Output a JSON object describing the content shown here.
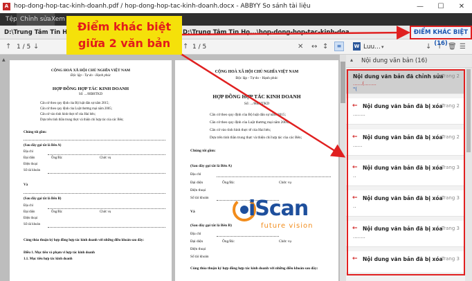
{
  "window": {
    "title": "hop-dong-hop-tac-kinh-doanh.pdf / hop-dong-hop-tac-kinh-doanh.docx - ABBYY So sánh tài liệu",
    "app_icon": "abbyy-pdf-icon"
  },
  "menu": {
    "items": [
      "Tệp",
      "Chỉnh sửa",
      "Xem"
    ]
  },
  "paths": {
    "left": "D:\\Trung Tâm Tin Học",
    "right": "D:\\Trung Tâm Tin Họ...\\hop-dong-hop-tac-kinh-doanh.docx"
  },
  "toolbar": {
    "left_page": "1 / 5",
    "right_page": "1 / 5",
    "language": "Luu...",
    "language_icon": "word-doc-icon"
  },
  "callout": {
    "line1": "Điểm khác biệt",
    "line2": "giữa 2 văn bản"
  },
  "diff_button": {
    "label": "ĐIỂM KHÁC BIỆT (16)"
  },
  "right_panel": {
    "group_header": "Nội dung văn bản (16)",
    "items": [
      {
        "title": "Nội dung văn bản đã chỉnh sửa",
        "page": "Trang 2",
        "snippet1": "......(........",
        "snippet2": "\"(",
        "type": "edited"
      },
      {
        "title": "Nội dung văn bản đã bị xóa",
        "page": "Trang 2",
        "snippet1": "........",
        "type": "deleted"
      },
      {
        "title": "Nội dung văn bản đã bị xóa",
        "page": "Trang 2",
        "snippet1": "......",
        "type": "deleted"
      },
      {
        "title": "Nội dung văn bản đã bị xóa",
        "page": "Trang 3",
        "snippet1": "..",
        "type": "deleted"
      },
      {
        "title": "Nội dung văn bản đã bị xóa",
        "page": "Trang 3",
        "snippet1": "..",
        "type": "deleted"
      },
      {
        "title": "Nội dung văn bản đã bị xóa",
        "page": "Trang 3",
        "snippet1": "........",
        "type": "deleted"
      },
      {
        "title": "Nội dung văn bản đã bị xóa",
        "page": "Trang 3",
        "snippet1": "",
        "type": "deleted"
      }
    ]
  },
  "watermark": {
    "brand": "iScan",
    "tagline": "future vision"
  },
  "doc_left": {
    "l1": "CỘNG HOÀ XÃ HỘI CHỦ NGHĨA VIỆT NAM",
    "l2": "Độc lập - Tự do - Hạnh phúc",
    "l3": "HỢP ĐỒNG HỢP TÁC KINH DOANH",
    "l4": "Số: .../HĐHTKD",
    "b1": "Căn cứ theo quy định của Bộ luật dân sự năm 2015;",
    "b2": "Căn cứ theo quy định của Luật thương mại năm 2005;",
    "b3": "Căn cứ vào tình hình thực tế của Hai bên;",
    "b4": "Dựa trên tinh thần trung thực và thiện chí hợp tác của các Bên;",
    "p1": "Chúng tôi gồm:",
    "p2": "(Sau đây gọi tắt là Bên A)",
    "f1": "Địa chỉ",
    "f2": "Đại diện",
    "f3": "Ông/Bà:",
    "f4": "Chức vụ",
    "f5": "Điện thoại",
    "f6": "Số tài khoản",
    "p3": "Và",
    "p4": "(Sau đây gọi tắt là Bên B)",
    "g1": "Địa chỉ",
    "g2": "Đại diện",
    "g3": "Ông/Bà:",
    "g4": "Chức vụ",
    "g5": "Điện thoại",
    "g6": "Số tài khoản",
    "p5": "Cùng thỏa thuận ký hợp đồng hợp tác kinh doanh với những điều khoản sau đây:",
    "p6": "Điều 1. Mục tiêu và phạm vi hợp tác kinh doanh",
    "p7": "1.1. Mục tiêu hợp tác kinh doanh"
  },
  "doc_right": {
    "l1": "CỘNG HOÀ XÃ HỘI CHỦ NGHĨA VIỆT NAM",
    "l2": "Độc lập - Tự do - Hạnh phúc",
    "l3": "HỢP ĐỒNG HỢP TÁC KINH DOANH",
    "l4": "Số: .../HĐHTKD",
    "b1": "Căn cứ theo quy định của Bộ luật dân sự năm 2015;",
    "b2": "Căn cứ theo quy định của Luật thương mại năm 2005;",
    "b3": "Căn cứ vào tình hình thực tế của Hai bên;",
    "b4": "Dựa trên tinh thần trung thực và thiện chí hợp tác của các Bên;",
    "p1": "Chúng tôi gồm:",
    "p2": "(Sau đây gọi tắt là Bên A)",
    "f1": "Địa chỉ",
    "f2": "Đại diện",
    "f3": "Ông/Bà:",
    "f4": "Chức vụ",
    "f5": "Điện thoại",
    "f6": "Số tài khoản",
    "p3": "Và",
    "p4": "(Sau đây gọi tắt là Bên B)",
    "g1": "Địa chỉ",
    "g2": "Đại diện",
    "g3": "Ông/Bà:",
    "g4": "Chức vụ",
    "g5": "Điện thoại",
    "g6": "Số tài khoản",
    "p5": "Cùng thỏa thuận ký hợp đồng hợp tác kinh doanh với những điều khoản sau đây:"
  },
  "colors": {
    "accent_red": "#e02020",
    "callout_yellow": "#f5e10a",
    "link_blue": "#1a56b0"
  }
}
